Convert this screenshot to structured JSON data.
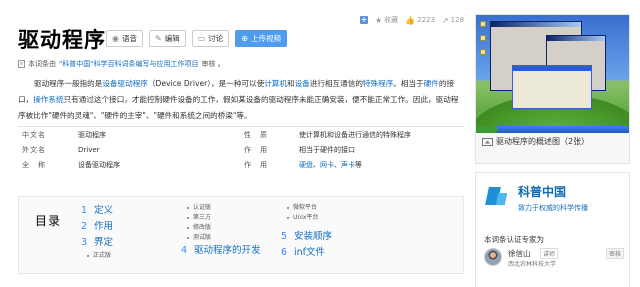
{
  "actions": {
    "add": "+",
    "collect": "收藏",
    "likes": "2223",
    "shares": "128"
  },
  "title": "驱动程序",
  "buttons": {
    "voice": "语音",
    "edit": "编辑",
    "discuss": "讨论",
    "upload_video": "上传视频"
  },
  "note": {
    "prefix": "本词条由",
    "link": "\"科普中国\"科学百科词条编写与应用工作项目",
    "suffix": "审核 。"
  },
  "summary": {
    "segments": [
      {
        "text": "驱动程序一般指的是",
        "link": false
      },
      {
        "text": "设备驱动程序",
        "link": true
      },
      {
        "text": "（Device Driver），是一种可以使",
        "link": false
      },
      {
        "text": "计算机",
        "link": true
      },
      {
        "text": "和",
        "link": false
      },
      {
        "text": "设备",
        "link": true
      },
      {
        "text": "进行相互通信的",
        "link": false
      },
      {
        "text": "特殊程序",
        "link": true
      },
      {
        "text": "。相当于",
        "link": false
      },
      {
        "text": "硬件",
        "link": true
      },
      {
        "text": "的接口，",
        "link": false
      },
      {
        "text": "操作系统",
        "link": true
      },
      {
        "text": "只有通过这个接口，才能控制硬件设备的工作，假如某设备的驱动程序未能正确安装，便不能正常工作。因此，驱动程序被比作\"硬件的灵魂\"、\"硬件的主宰\"、\"硬件和系统之间的桥梁\"等。",
        "link": false
      }
    ]
  },
  "basic_info": [
    {
      "k1": "中文名",
      "v1": "驱动程序",
      "k2": "性　质",
      "v2": [
        {
          "text": "使计算机和设备进行通信的特殊程序",
          "link": false
        }
      ]
    },
    {
      "k1": "外文名",
      "v1": "Driver",
      "k2": "作　用",
      "v2": [
        {
          "text": "相当于硬件的接口",
          "link": false
        }
      ]
    },
    {
      "k1": "全　称",
      "v1": "设备驱动程序",
      "k2": "作　用",
      "v2": [
        {
          "text": "硬盘",
          "link": true
        },
        {
          "text": "、",
          "link": false
        },
        {
          "text": "网卡",
          "link": true
        },
        {
          "text": "、",
          "link": false
        },
        {
          "text": "声卡",
          "link": true
        },
        {
          "text": "等",
          "link": false
        }
      ]
    }
  ],
  "catalog": {
    "title": "目录",
    "col1": [
      {
        "num": "1",
        "label": "定义",
        "subs": []
      },
      {
        "num": "2",
        "label": "作用",
        "subs": []
      },
      {
        "num": "3",
        "label": "界定",
        "subs": [
          "正式版"
        ]
      }
    ],
    "col2_subs": [
      "认证版",
      "第三方",
      "修改版",
      "测试版"
    ],
    "col2_main": {
      "num": "4",
      "label": "驱动程序的开发"
    },
    "col3_subs": [
      "微软平台",
      "Unix平台"
    ],
    "col3_main": [
      {
        "num": "5",
        "label": "安装顺序"
      },
      {
        "num": "6",
        "label": "inf文件"
      }
    ]
  },
  "gallery": {
    "caption": "驱动程序的概述图（2张）"
  },
  "expert": {
    "brand": "科普中国",
    "slogan": "致力于权威的科学传播",
    "heading": "本词条认证专家为",
    "name": "徐信山",
    "title": "讲师",
    "audit": "审核",
    "org": "西北农林科技大学"
  },
  "colors": {
    "link": "#136ec2",
    "primary_button": "#4f9cee",
    "brand_blue": "#0f6ab5"
  }
}
